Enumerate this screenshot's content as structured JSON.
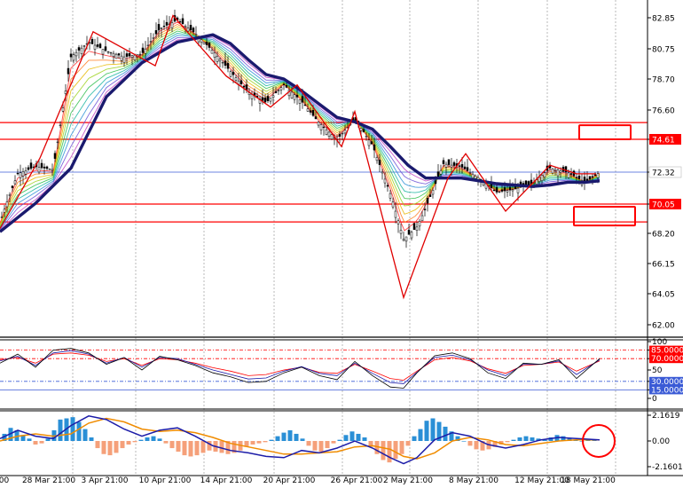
{
  "chart_data": {
    "type": "line",
    "title": "",
    "colors": {
      "background": "#ffffff",
      "grid": "#8c8c8c",
      "candle": "#000000",
      "ma_thick": "#1a1a6e",
      "resistance_line": "#ff0000",
      "current_price_line": "#3b5bd6",
      "zigzag": "#e00000",
      "histogram_positive": "#2a8fd6",
      "histogram_negative": "#f5a07a",
      "macd_line": "#1c1ca8",
      "signal_line": "#f08c00"
    },
    "price_axis": {
      "ticks": [
        "82.85",
        "80.75",
        "78.70",
        "76.60",
        "74.61",
        "72.32",
        "70.05",
        "68.20",
        "66.15",
        "64.05",
        "62.00"
      ],
      "tick_values": [
        82.85,
        80.75,
        78.7,
        76.6,
        74.61,
        72.32,
        70.05,
        68.2,
        66.15,
        64.05,
        62.0
      ],
      "ylim": [
        60.2,
        83.4
      ]
    },
    "date_axis": {
      "ticks": [
        ":00",
        "28 Mar 21:00",
        "3 Apr 21:00",
        "10 Apr 21:00",
        "14 Apr 21:00",
        "20 Apr 21:00",
        "26 Apr 21:00",
        "2 May 21:00",
        "8 May 21:00",
        "12 May 21:00",
        "18 May 21:00"
      ]
    },
    "horizontal_levels": [
      {
        "label": "75.75",
        "value": 75.75,
        "color": "#ff0000"
      },
      {
        "label": "74.61",
        "value": 74.61,
        "color": "#ff0000"
      },
      {
        "label": "70.05",
        "value": 70.05,
        "color": "#ff0000"
      },
      {
        "label": "68.92",
        "value": 68.92,
        "color": "#ff0000"
      }
    ],
    "current_price": {
      "label": "72.32",
      "value": 72.32
    },
    "main_series": {
      "x": [
        0,
        20,
        40,
        60,
        80,
        100,
        120,
        140,
        160,
        180,
        200,
        220,
        240,
        260,
        280,
        300,
        320,
        340,
        360,
        380,
        400,
        420,
        440,
        455,
        470,
        480,
        500,
        520,
        540,
        560,
        580,
        600,
        620,
        640,
        660,
        676
      ],
      "close": [
        68.9,
        72.2,
        72.7,
        72.5,
        80.2,
        81.2,
        80.6,
        80.2,
        80.4,
        82.1,
        82.7,
        81.8,
        80.6,
        79.2,
        77.8,
        77.1,
        78.3,
        77.2,
        75.7,
        74.6,
        76.0,
        74.2,
        70.8,
        67.8,
        68.6,
        69.8,
        72.9,
        72.7,
        71.9,
        70.9,
        71.1,
        71.5,
        72.6,
        72.3,
        71.6,
        72.3
      ]
    },
    "slow_ma": {
      "x": [
        0,
        40,
        80,
        120,
        160,
        200,
        240,
        260,
        280,
        300,
        320,
        340,
        360,
        380,
        400,
        420,
        440,
        460,
        480,
        500,
        520,
        540,
        560,
        580,
        600,
        620,
        640,
        660,
        676
      ],
      "values": [
        68.3,
        70.1,
        72.6,
        77.5,
        79.8,
        81.2,
        81.7,
        81.1,
        80.0,
        79.0,
        78.7,
        77.9,
        77.0,
        76.1,
        75.8,
        75.3,
        74.1,
        72.8,
        71.9,
        71.9,
        71.9,
        71.7,
        71.5,
        71.4,
        71.3,
        71.4,
        71.6,
        71.6,
        71.7
      ]
    },
    "zigzag": {
      "x": [
        0,
        45,
        105,
        175,
        195,
        255,
        305,
        335,
        385,
        400,
        455,
        505,
        525,
        570,
        620,
        650,
        672
      ],
      "values": [
        68.5,
        73.3,
        81.9,
        79.6,
        83.0,
        78.9,
        76.8,
        78.3,
        74.1,
        76.5,
        63.8,
        71.9,
        73.6,
        69.6,
        72.8,
        72.2,
        72.2
      ]
    },
    "rsi_panel": {
      "ticks": [
        "100",
        "85.0000",
        "70.0000",
        "50",
        "30.0000",
        "15.0000",
        "0"
      ],
      "tick_values": [
        100,
        85,
        70,
        50,
        30,
        15,
        0
      ],
      "levels": [
        {
          "label": "85.0000",
          "value": 85,
          "color": "#ff0000",
          "dash": true
        },
        {
          "label": "70.0000",
          "value": 70,
          "color": "#ff0000",
          "dash": true
        },
        {
          "label": "30.0000",
          "value": 30,
          "color": "#3b5bd6",
          "dash": true
        },
        {
          "label": "15.0000",
          "value": 15,
          "color": "#3b5bd6",
          "dash": false
        }
      ],
      "x": [
        0,
        20,
        40,
        60,
        80,
        100,
        120,
        140,
        160,
        180,
        200,
        220,
        240,
        260,
        280,
        300,
        320,
        340,
        360,
        380,
        400,
        420,
        440,
        455,
        470,
        490,
        510,
        530,
        550,
        570,
        590,
        610,
        630,
        650,
        676
      ],
      "black": [
        62,
        78,
        55,
        85,
        88,
        80,
        60,
        72,
        50,
        74,
        68,
        58,
        45,
        38,
        28,
        30,
        45,
        55,
        40,
        33,
        65,
        40,
        20,
        18,
        45,
        75,
        80,
        70,
        45,
        35,
        62,
        60,
        68,
        35,
        70
      ],
      "red": [
        68,
        72,
        62,
        78,
        80,
        76,
        65,
        70,
        58,
        70,
        68,
        62,
        54,
        48,
        40,
        42,
        50,
        55,
        46,
        44,
        60,
        48,
        35,
        32,
        48,
        68,
        72,
        66,
        52,
        44,
        58,
        60,
        64,
        48,
        66
      ],
      "blue": [
        66,
        74,
        58,
        80,
        84,
        78,
        62,
        72,
        55,
        72,
        70,
        60,
        50,
        42,
        34,
        36,
        48,
        56,
        44,
        40,
        62,
        44,
        28,
        26,
        46,
        72,
        76,
        68,
        50,
        40,
        60,
        60,
        66,
        42,
        68
      ]
    },
    "macd_panel": {
      "ticks": [
        "2.1619",
        "0.00",
        "-2.1601"
      ],
      "tick_values": [
        2.1619,
        0,
        -2.1601
      ],
      "ylim": [
        -2.6,
        2.6
      ],
      "histogram": {
        "x": [
          5,
          12,
          19,
          26,
          33,
          40,
          47,
          54,
          61,
          68,
          75,
          82,
          89,
          96,
          103,
          110,
          117,
          124,
          131,
          138,
          145,
          152,
          159,
          166,
          173,
          180,
          187,
          194,
          201,
          208,
          215,
          222,
          229,
          236,
          243,
          250,
          257,
          264,
          271,
          278,
          285,
          292,
          299,
          306,
          313,
          320,
          327,
          334,
          341,
          348,
          355,
          362,
          369,
          376,
          383,
          390,
          397,
          404,
          411,
          418,
          425,
          432,
          439,
          446,
          453,
          460,
          467,
          474,
          481,
          488,
          495,
          502,
          509,
          516,
          523,
          530,
          537,
          544,
          551,
          558,
          565,
          572,
          579,
          586,
          593,
          600,
          607,
          614,
          621,
          628,
          635,
          642,
          649,
          656,
          663,
          670
        ],
        "values": [
          0.6,
          1.1,
          0.9,
          0.5,
          0.2,
          -0.3,
          -0.2,
          0.2,
          0.9,
          1.8,
          1.9,
          2.0,
          1.6,
          1.0,
          0.3,
          -0.6,
          -1.1,
          -1.2,
          -1.0,
          -0.6,
          -0.3,
          -0.1,
          0.1,
          0.3,
          0.4,
          0.2,
          -0.2,
          -0.6,
          -0.9,
          -1.2,
          -1.3,
          -1.2,
          -1.0,
          -0.8,
          -0.9,
          -1.0,
          -1.1,
          -1.0,
          -0.8,
          -0.5,
          -0.3,
          -0.2,
          -0.1,
          0.1,
          0.4,
          0.7,
          0.9,
          0.6,
          0.2,
          -0.4,
          -0.8,
          -0.9,
          -0.6,
          -0.2,
          0.1,
          0.5,
          0.8,
          0.6,
          0.3,
          -0.5,
          -1.1,
          -1.6,
          -1.8,
          -1.5,
          -1.1,
          -0.4,
          0.4,
          1.0,
          1.7,
          1.9,
          1.6,
          1.2,
          0.8,
          0.4,
          0.0,
          -0.4,
          -0.7,
          -0.8,
          -0.7,
          -0.5,
          -0.3,
          -0.1,
          0.1,
          0.3,
          0.4,
          0.3,
          0.2,
          0.1,
          0.3,
          0.5,
          0.4,
          0.2,
          0.1,
          0.0,
          0.05,
          0.1
        ]
      },
      "macd_line": {
        "x": [
          0,
          20,
          40,
          60,
          80,
          100,
          120,
          140,
          160,
          180,
          200,
          220,
          240,
          260,
          280,
          300,
          320,
          340,
          360,
          380,
          400,
          420,
          440,
          455,
          470,
          490,
          510,
          530,
          550,
          570,
          590,
          610,
          630,
          650,
          676
        ],
        "values": [
          0.2,
          0.9,
          0.4,
          0.2,
          1.3,
          2.1,
          1.8,
          1.0,
          0.4,
          0.9,
          1.1,
          0.4,
          -0.4,
          -0.8,
          -1.0,
          -1.3,
          -1.4,
          -0.8,
          -1.0,
          -0.6,
          0.0,
          -0.6,
          -1.4,
          -1.9,
          -1.4,
          0.1,
          0.7,
          0.4,
          -0.3,
          -0.6,
          -0.3,
          0.1,
          0.3,
          0.2,
          0.1
        ]
      },
      "signal_line": {
        "x": [
          0,
          20,
          40,
          60,
          80,
          100,
          120,
          140,
          160,
          180,
          200,
          220,
          240,
          260,
          280,
          300,
          320,
          340,
          360,
          380,
          400,
          420,
          440,
          455,
          470,
          490,
          510,
          530,
          550,
          570,
          590,
          610,
          630,
          650,
          676
        ],
        "values": [
          0.0,
          0.4,
          0.6,
          0.4,
          0.6,
          1.5,
          1.9,
          1.6,
          1.0,
          0.8,
          0.9,
          0.7,
          0.3,
          -0.2,
          -0.5,
          -0.8,
          -1.1,
          -1.1,
          -1.0,
          -0.9,
          -0.5,
          -0.4,
          -0.7,
          -1.3,
          -1.5,
          -1.0,
          0.0,
          0.3,
          0.1,
          -0.3,
          -0.4,
          -0.2,
          0.0,
          0.1,
          0.1
        ]
      }
    }
  }
}
